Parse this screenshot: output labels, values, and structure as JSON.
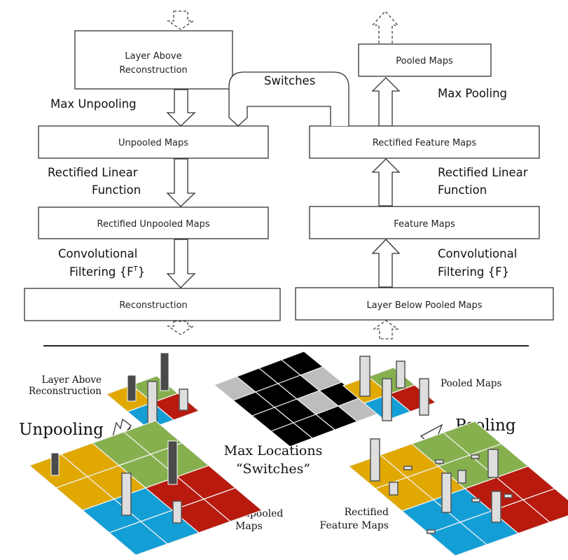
{
  "top": {
    "deconv": {
      "boxes": [
        "Layer Above Reconstruction",
        "Unpooled Maps",
        "Rectified Unpooled Maps",
        "Reconstruction"
      ],
      "box_lines": [
        [
          "Layer Above",
          "Reconstruction"
        ]
      ],
      "labels": {
        "max_unpooling": "Max Unpooling",
        "relu_1": "Rectified Linear",
        "relu_2": "Function",
        "conv_1": "Convolutional",
        "conv_2": "Filtering {F",
        "conv_sup": "T",
        "conv_end": "}"
      }
    },
    "conv": {
      "boxes": [
        "Pooled Maps",
        "Rectified Feature Maps",
        "Feature Maps",
        "Layer Below Pooled Maps"
      ],
      "labels": {
        "max_pooling": "Max Pooling",
        "relu_1": "Rectified Linear",
        "relu_2": "Function",
        "conv_1": "Convolutional",
        "conv_2": "Filtering {F}"
      }
    },
    "switches": "Switches"
  },
  "bottom": {
    "layer_above_1": "Layer Above",
    "layer_above_2": "Reconstruction",
    "unpooling": "Unpooling",
    "max_locations": "Max Locations",
    "switches": "“Switches”",
    "unpooled_1": "Unpooled",
    "unpooled_2": "Maps",
    "pooled_maps": "Pooled Maps",
    "pooling": "Pooling",
    "rectified_1": "Rectified",
    "rectified_2": "Feature Maps",
    "colors": {
      "yellow": "#e0a800",
      "green": "#86b04e",
      "blue": "#139ed6",
      "red": "#b81a0e",
      "switch_on": "#bdbdbd",
      "switch_off": "#000000"
    },
    "switch_grid": [
      [
        1,
        0,
        0,
        0
      ],
      [
        0,
        0,
        0,
        1
      ],
      [
        0,
        0,
        1,
        0
      ],
      [
        0,
        0,
        0,
        1
      ]
    ]
  }
}
